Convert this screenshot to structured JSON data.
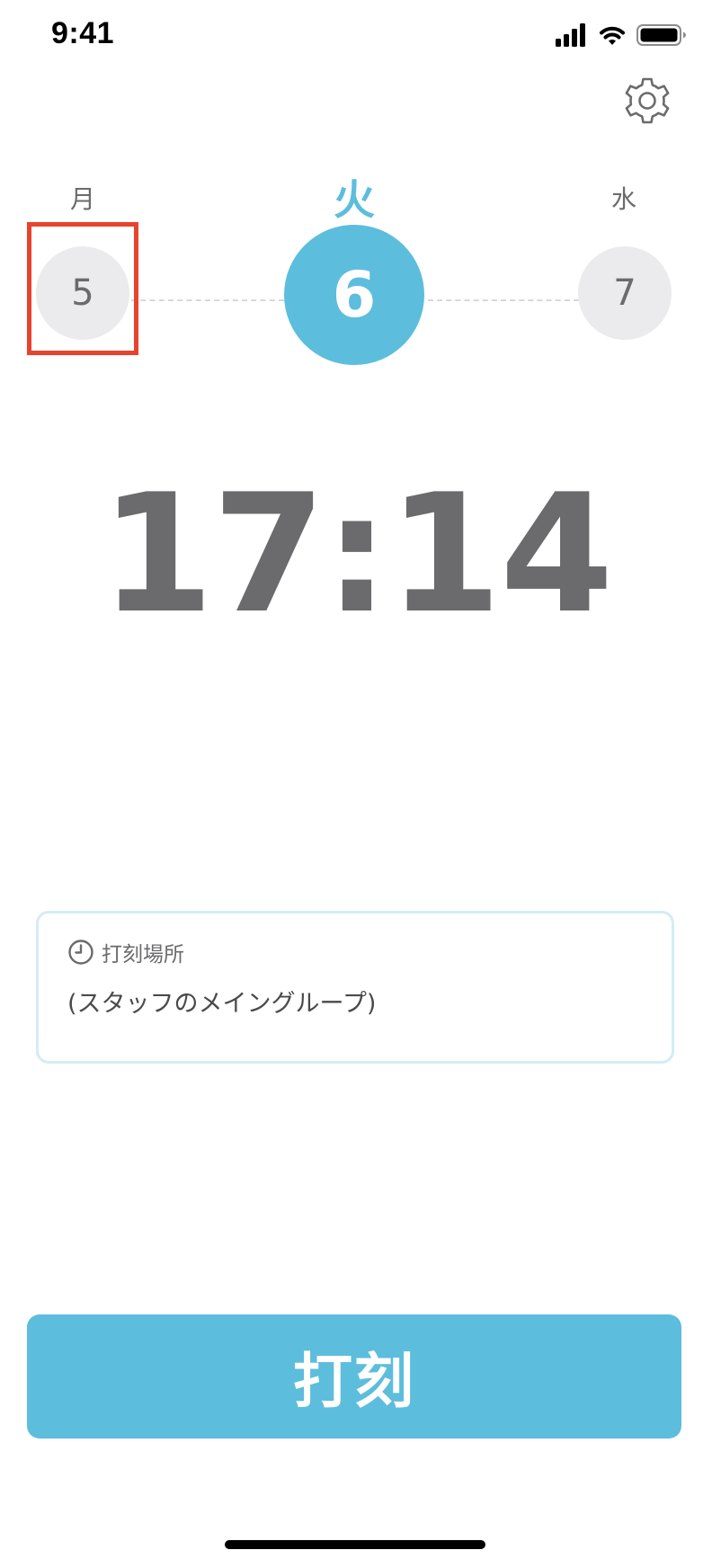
{
  "status_bar": {
    "time": "9:41",
    "icons": [
      "cellular-signal-icon",
      "wifi-icon",
      "battery-icon"
    ]
  },
  "header": {
    "settings_icon": "gear-icon"
  },
  "week": {
    "days": [
      {
        "weekday": "月",
        "date": "5",
        "selected": false
      },
      {
        "weekday": "火",
        "date": "6",
        "selected": true
      },
      {
        "weekday": "水",
        "date": "7",
        "selected": false
      }
    ]
  },
  "clock": {
    "time": "17:14"
  },
  "location": {
    "icon": "clock-icon",
    "label": "打刻場所",
    "value": "(スタッフのメイングループ)"
  },
  "action": {
    "punch_label": "打刻"
  },
  "colors": {
    "accent": "#5dbddc",
    "text": "#6b6a6c",
    "highlight": "#e8432c",
    "inactive_circle": "#ebebed",
    "card_border": "#d4ecf5"
  }
}
